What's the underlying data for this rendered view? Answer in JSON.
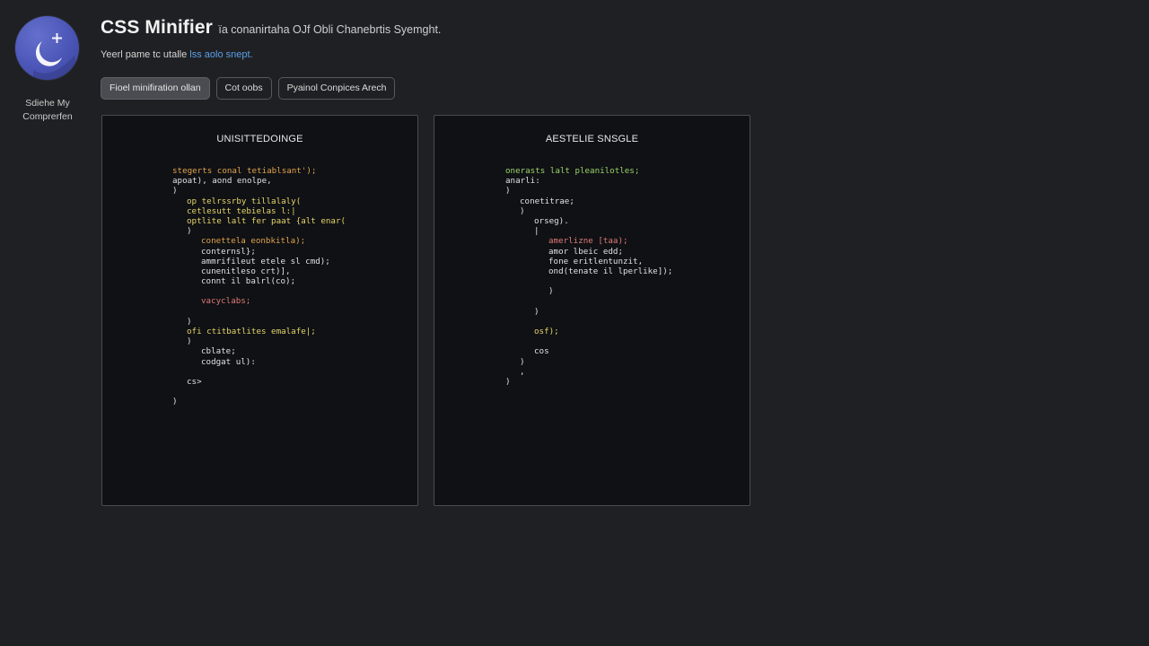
{
  "sidebar": {
    "caption_line1": "Sdiehe My",
    "caption_line2": "Comprerfen",
    "logo_icon": "moon-plus-logo-icon"
  },
  "header": {
    "title": "CSS Minifier",
    "title_suffix": "ïa conanirtaha OJf Obli Chanebrtis Syemght.",
    "subtitle_text": "Yeerl pame tc utalle ",
    "subtitle_link": "lss aolo snept."
  },
  "toolbar": {
    "buttons": [
      {
        "label": "Fioel minifiration ollan",
        "active": true
      },
      {
        "label": "Cot oobs",
        "active": false
      },
      {
        "label": "Pyainol Conpices Arech",
        "active": false
      }
    ]
  },
  "colors": {
    "orange": "#e0a24e",
    "yellow": "#e6d36a",
    "red": "#e07a78",
    "light": "#dde0e8",
    "green": "#9ad36a",
    "gray": "#b8bcc6",
    "link_blue": "#5aa0ea",
    "logo_blue": "#4b55b6"
  },
  "panels": {
    "left": {
      "title": "UNISITTEDOINGE",
      "lines": [
        {
          "indent": 0,
          "color": "orange",
          "text": "stegerts conal tetiablsant');"
        },
        {
          "indent": 0,
          "color": "light",
          "text": "apoat), aond enolpe,"
        },
        {
          "indent": 0,
          "color": "light",
          "text": ")"
        },
        {
          "indent": 2,
          "color": "yellow",
          "text": "op telrssrby tillalaly("
        },
        {
          "indent": 2,
          "color": "yellow",
          "text": "cetlesutt tebielas l:|"
        },
        {
          "indent": 2,
          "color": "yellow",
          "text": "optlite lalt fer paat {alt enar("
        },
        {
          "indent": 2,
          "color": "light",
          "text": ")"
        },
        {
          "indent": 4,
          "color": "orange",
          "text": "conettela eonbkitla);"
        },
        {
          "indent": 4,
          "color": "light",
          "text": "conternsl};"
        },
        {
          "indent": 4,
          "color": "light",
          "text": "ammrifileut etele sl cmd);"
        },
        {
          "indent": 4,
          "color": "light",
          "text": "cunenitleso crt)],"
        },
        {
          "indent": 4,
          "color": "light",
          "text": "connt il balrl(co);"
        },
        {
          "indent": 0,
          "color": "light",
          "text": ""
        },
        {
          "indent": 4,
          "color": "red",
          "text": "vacyclabs;"
        },
        {
          "indent": 0,
          "color": "light",
          "text": ""
        },
        {
          "indent": 2,
          "color": "light",
          "text": ")"
        },
        {
          "indent": 2,
          "color": "yellow",
          "text": "ofi ctitbatlites emalafe|;"
        },
        {
          "indent": 2,
          "color": "light",
          "text": ")"
        },
        {
          "indent": 4,
          "color": "light",
          "text": "cblate;"
        },
        {
          "indent": 4,
          "color": "light",
          "text": "codgat ul):"
        },
        {
          "indent": 0,
          "color": "light",
          "text": ""
        },
        {
          "indent": 2,
          "color": "light",
          "text": "cs>"
        },
        {
          "indent": 0,
          "color": "light",
          "text": ""
        },
        {
          "indent": 0,
          "color": "light",
          "text": ")"
        }
      ]
    },
    "right": {
      "title": "AESTELIE SNSGLE",
      "lines": [
        {
          "indent": 0,
          "color": "green",
          "text": "onerasts lalt pleanilotles;"
        },
        {
          "indent": 0,
          "color": "light",
          "text": "anarli:"
        },
        {
          "indent": 0,
          "color": "light",
          "text": ")"
        },
        {
          "indent": 2,
          "color": "light",
          "text": "conetitrae;"
        },
        {
          "indent": 2,
          "color": "light",
          "text": ")"
        },
        {
          "indent": 4,
          "color": "light",
          "text": "orseg)."
        },
        {
          "indent": 4,
          "color": "light",
          "text": "|"
        },
        {
          "indent": 6,
          "color": "red",
          "text": "amerlizne [taa);"
        },
        {
          "indent": 6,
          "color": "light",
          "text": "amor lbeic edd;"
        },
        {
          "indent": 6,
          "color": "light",
          "text": "fone eritlentunzit,"
        },
        {
          "indent": 6,
          "color": "light",
          "text": "ond(tenate il lperlike]);"
        },
        {
          "indent": 0,
          "color": "light",
          "text": ""
        },
        {
          "indent": 6,
          "color": "light",
          "text": ")"
        },
        {
          "indent": 0,
          "color": "light",
          "text": ""
        },
        {
          "indent": 4,
          "color": "light",
          "text": ")"
        },
        {
          "indent": 0,
          "color": "light",
          "text": ""
        },
        {
          "indent": 4,
          "color": "yellow",
          "text": "osf);"
        },
        {
          "indent": 0,
          "color": "light",
          "text": ""
        },
        {
          "indent": 4,
          "color": "light",
          "text": "cos"
        },
        {
          "indent": 2,
          "color": "light",
          "text": ")"
        },
        {
          "indent": 2,
          "color": "light",
          "text": ","
        },
        {
          "indent": 0,
          "color": "light",
          "text": ")"
        }
      ]
    }
  }
}
